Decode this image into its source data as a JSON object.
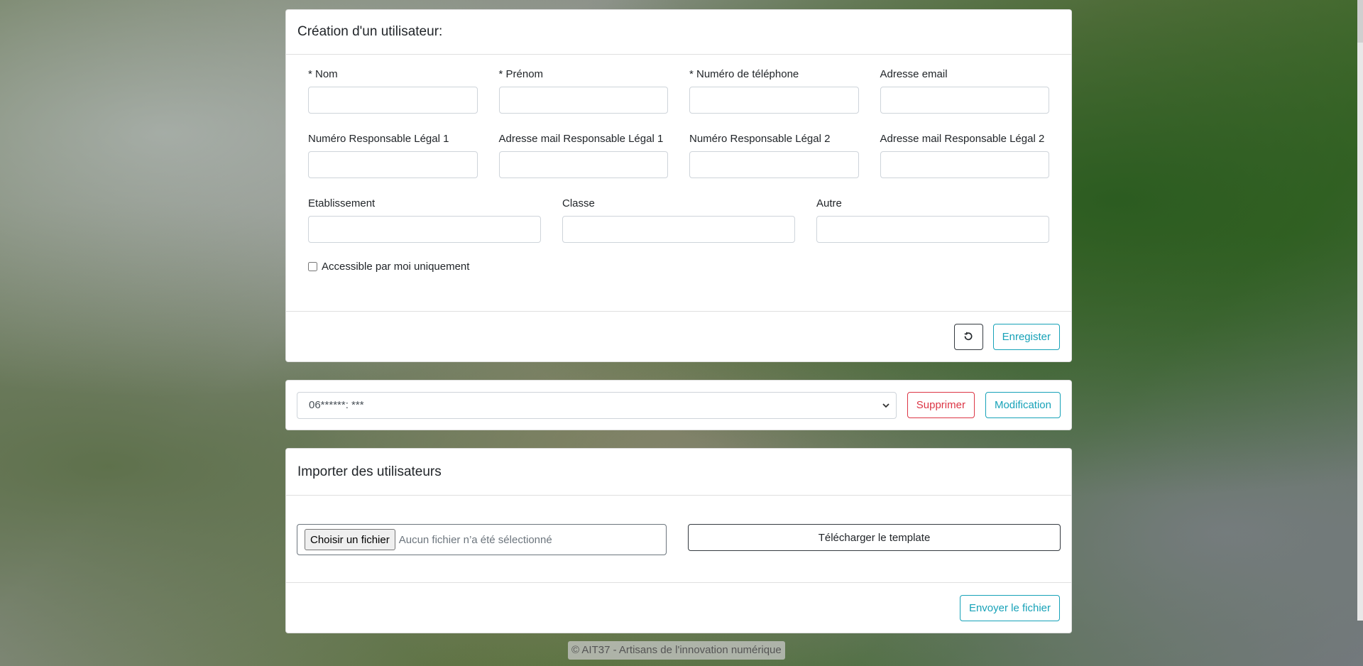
{
  "create_user": {
    "title": "Création d'un utilisateur:",
    "fields_row1": [
      {
        "label": "* Nom",
        "value": ""
      },
      {
        "label": "* Prénom",
        "value": ""
      },
      {
        "label": "* Numéro de téléphone",
        "value": ""
      },
      {
        "label": "Adresse email",
        "value": ""
      }
    ],
    "fields_row2": [
      {
        "label": "Numéro Responsable Légal 1",
        "value": ""
      },
      {
        "label": "Adresse mail Responsable Légal 1",
        "value": ""
      },
      {
        "label": "Numéro Responsable Légal 2",
        "value": ""
      },
      {
        "label": "Adresse mail Responsable Légal 2",
        "value": ""
      }
    ],
    "fields_row3": [
      {
        "label": "Etablissement",
        "value": ""
      },
      {
        "label": "Classe",
        "value": ""
      },
      {
        "label": "Autre",
        "value": ""
      }
    ],
    "checkbox_label": "Accessible par moi uniquement",
    "checkbox_checked": false,
    "reset_icon": "rotate-ccw-icon",
    "save_label": "Enregister"
  },
  "user_select": {
    "selected": "06******: ***",
    "delete_label": "Supprimer",
    "edit_label": "Modification"
  },
  "import": {
    "title": "Importer des utilisateurs",
    "choose_file_label": "Choisir un fichier",
    "no_file_text": "Aucun fichier n’a été sélectionné",
    "download_template_label": "Télécharger le template",
    "send_label": "Envoyer le fichier"
  },
  "footer": {
    "credit": "© AIT37 - Artisans de l'innovation numérique"
  },
  "colors": {
    "info": "#17a2b8",
    "danger": "#dc3545",
    "dark": "#343a40"
  }
}
